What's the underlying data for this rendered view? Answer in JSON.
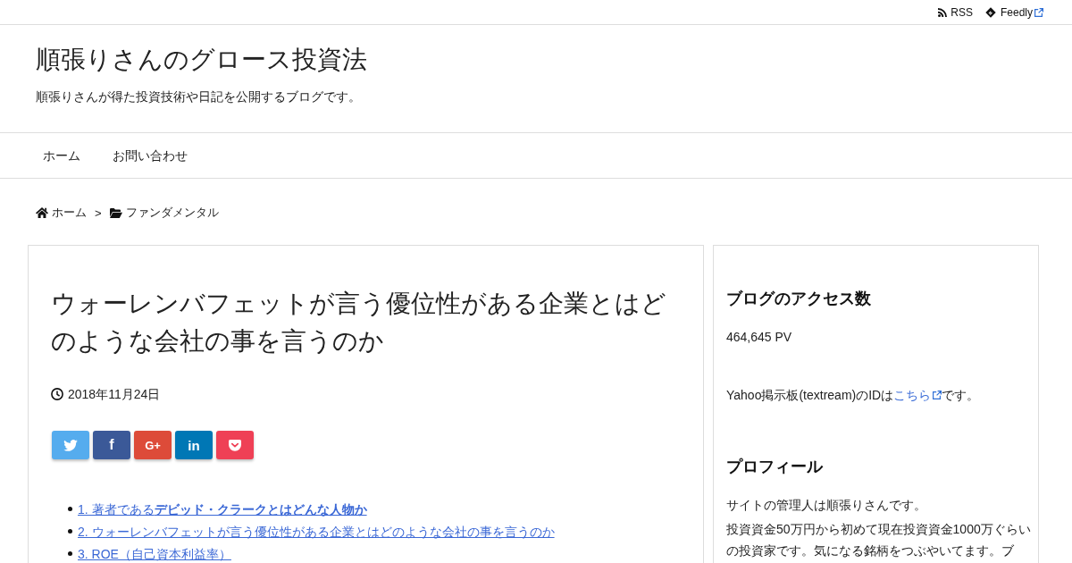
{
  "top_bar": {
    "links": [
      {
        "kind": "rss",
        "label": "RSS",
        "external": false
      },
      {
        "kind": "feedly",
        "label": "Feedly",
        "external": true
      }
    ]
  },
  "header": {
    "site_title": "順張りさんのグロース投資法",
    "tagline": "順張りさんが得た投資技術や日記を公開するブログです。"
  },
  "nav": {
    "items": [
      {
        "label": "ホーム"
      },
      {
        "label": "お問い合わせ"
      }
    ]
  },
  "breadcrumb": {
    "items": [
      {
        "kind": "home",
        "label": "ホーム"
      },
      {
        "kind": "category",
        "label": "ファンダメンタル"
      }
    ],
    "separator": ">"
  },
  "article": {
    "title": "ウォーレンバフェットが言う優位性がある企業とはどのような会社の事を言うのか",
    "date": "2018年11月24日",
    "share_buttons": [
      {
        "kind": "twitter"
      },
      {
        "kind": "facebook",
        "label": "f"
      },
      {
        "kind": "googleplus",
        "label": "G+"
      },
      {
        "kind": "linkedin",
        "label": "in"
      },
      {
        "kind": "pocket"
      }
    ],
    "toc": [
      {
        "label": "1. 著者である**デビッド・クラークとはどんな人物か**"
      },
      {
        "label": "2. ウォーレンバフェットが言う優位性がある企業とはどのような会社の事を言うのか"
      },
      {
        "label": "3. ROE（自己資本利益率）"
      }
    ]
  },
  "sidebar": {
    "widgets": [
      {
        "title": "ブログのアクセス数",
        "paragraphs": [
          {
            "kind": "text",
            "text": "464,645 PV"
          }
        ]
      },
      {
        "paragraphs": [
          {
            "kind": "link_sentence",
            "before": "Yahoo掲示板(textream)のIDは",
            "link": "こちら",
            "after": "です。",
            "external": true
          }
        ]
      },
      {
        "title": "プロフィール",
        "paragraphs": [
          {
            "kind": "text",
            "text": "サイトの管理人は順張りさんです。"
          },
          {
            "kind": "text",
            "text": "投資資金50万円から初めて現在投資資金1000万ぐらいの投資家です。気になる銘柄をつぶやいてます。ブ"
          }
        ]
      }
    ]
  }
}
